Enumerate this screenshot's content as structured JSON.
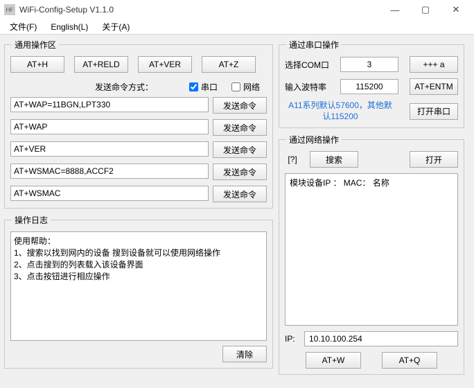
{
  "window": {
    "title": "WiFi-Config-Setup V1.1.0",
    "icon_text": "HF"
  },
  "menu": {
    "file": "文件(F)",
    "english": "English(L)",
    "about": "关于(A)"
  },
  "general": {
    "legend": "通用操作区",
    "btn_h": "AT+H",
    "btn_reld": "AT+RELD",
    "btn_ver": "AT+VER",
    "btn_z": "AT+Z",
    "send_mode_label": "发送命令方式：",
    "cb_serial": "串口",
    "cb_net": "网络",
    "cmd1": "AT+WAP=11BGN,LPT330",
    "cmd2": "AT+WAP",
    "cmd3": "AT+VER",
    "cmd4": "AT+WSMAC=8888,ACCF2",
    "cmd5": "AT+WSMAC",
    "send_btn": "发送命令"
  },
  "log": {
    "legend": "操作日志",
    "text": "使用帮助：\n1、搜索以找到网内的设备 搜到设备就可以使用网络操作\n2、点击搜到的列表载入该设备界面\n3、点击按钮进行相应操作",
    "clear": "清除"
  },
  "serial": {
    "legend": "通过串口操作",
    "com_label": "选择COM口",
    "com_value": "3",
    "btn_plusa": "+++ a",
    "baud_label": "输入波特率",
    "baud_value": "115200",
    "btn_entm": "AT+ENTM",
    "hint": "A11系列默认57600，其他默认115200",
    "btn_open": "打开串口"
  },
  "net": {
    "legend": "通过网络操作",
    "qmark": "[?]",
    "btn_search": "搜索",
    "btn_open": "打开",
    "device_header": "模块设备IP  ： MAC： 名称",
    "ip_label": "IP:",
    "ip_value": "10.10.100.254",
    "btn_w": "AT+W",
    "btn_q": "AT+Q"
  }
}
